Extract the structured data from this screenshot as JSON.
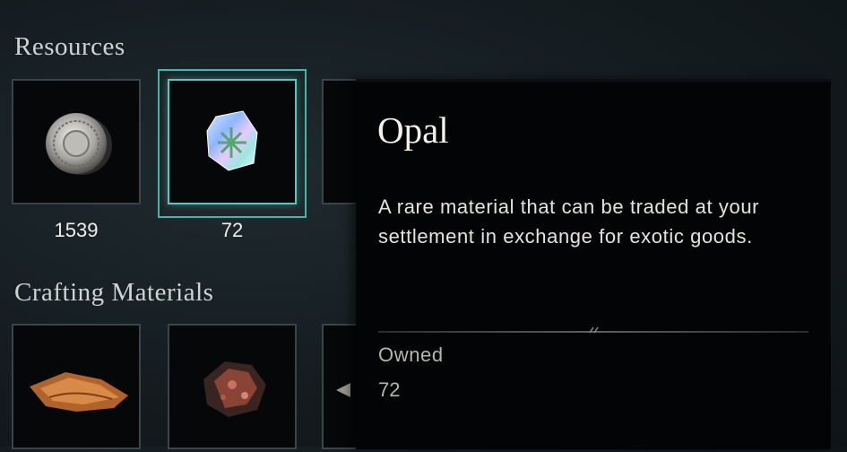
{
  "sections": {
    "resources": {
      "title": "Resources",
      "items": [
        {
          "name": "Silver",
          "icon": "silver-coin-icon",
          "count": "1539"
        },
        {
          "name": "Opal",
          "icon": "opal-gem-icon",
          "count": "72",
          "selected": true
        }
      ]
    },
    "crafting": {
      "title": "Crafting Materials",
      "items": [
        {
          "icon": "leather-icon"
        },
        {
          "icon": "iron-ore-icon"
        }
      ]
    }
  },
  "tooltip": {
    "title": "Opal",
    "description": "A rare material that can be traded at your settlement in exchange for exotic goods.",
    "owned_label": "Owned",
    "owned_value": "72"
  },
  "colors": {
    "selection": "#58c7bf",
    "slot_border": "#3a4549",
    "tooltip_bg": "#030405"
  }
}
